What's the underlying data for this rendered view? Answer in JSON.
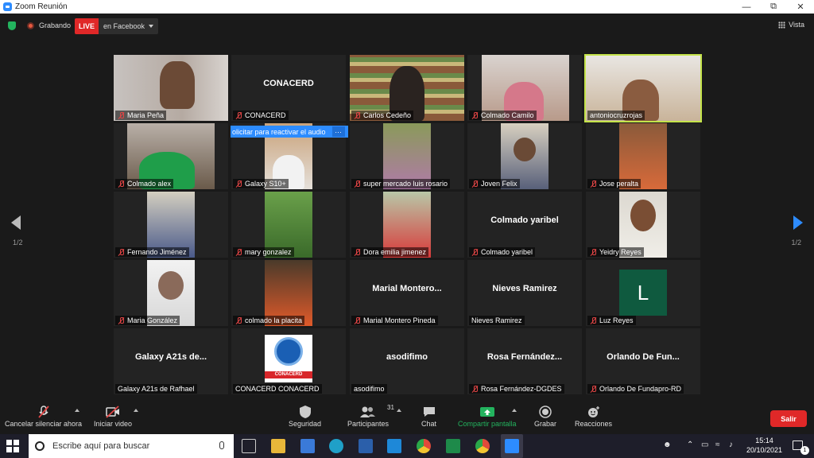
{
  "window": {
    "title": "Zoom Reunión"
  },
  "topbar": {
    "recording_label": "Grabando",
    "live_label": "LIVE",
    "live_destination": "en Facebook",
    "view_label": "Vista"
  },
  "navigation": {
    "page_left": "1/2",
    "page_right": "1/2"
  },
  "popup": {
    "text": "olicitar para reactivar el audio",
    "more": "···"
  },
  "tiles": [
    {
      "name": "Maria Peña",
      "big": ""
    },
    {
      "name": "CONACERD",
      "big": "CONACERD"
    },
    {
      "name": "Carlos Cedeño",
      "big": ""
    },
    {
      "name": "Colmado Camilo",
      "big": ""
    },
    {
      "name": "antoniocruzrojas",
      "big": ""
    },
    {
      "name": "Colmado alex",
      "big": ""
    },
    {
      "name": "Galaxy S10+",
      "big": ""
    },
    {
      "name": "super mercado luis rosario",
      "big": ""
    },
    {
      "name": "Joven Felix",
      "big": ""
    },
    {
      "name": "Jose peralta",
      "big": ""
    },
    {
      "name": "Fernando Jiménez",
      "big": ""
    },
    {
      "name": "mary gonzalez",
      "big": ""
    },
    {
      "name": "Dora emilia jimenez",
      "big": ""
    },
    {
      "name": "Colmado yaribel",
      "big": "Colmado yaribel"
    },
    {
      "name": "Yeidry Reyes",
      "big": ""
    },
    {
      "name": "Maria González",
      "big": ""
    },
    {
      "name": "colmado la placita",
      "big": ""
    },
    {
      "name": "Marial Montero Pineda",
      "big": "Marial Montero..."
    },
    {
      "name": "Nieves Ramirez",
      "big": "Nieves Ramirez"
    },
    {
      "name": "Luz Reyes",
      "big": "",
      "letter": "L"
    },
    {
      "name": "Galaxy A21s de Rafhael",
      "big": "Galaxy A21s de..."
    },
    {
      "name": "CONACERD CONACERD",
      "big": "",
      "logo_text": "CONACERD"
    },
    {
      "name": "asodifimo",
      "big": "asodifimo"
    },
    {
      "name": "Rosa Fernández-DGDES",
      "big": "Rosa Fernández..."
    },
    {
      "name": "Orlando De Fundapro-RD",
      "big": "Orlando De Fun..."
    }
  ],
  "toolbar": {
    "unmute": "Cancelar silenciar ahora",
    "start_video": "Iniciar video",
    "security": "Seguridad",
    "participants": "Participantes",
    "participants_count": "31",
    "chat": "Chat",
    "share": "Compartir pantalla",
    "record": "Grabar",
    "reactions": "Reacciones",
    "leave": "Salir"
  },
  "taskbar": {
    "search_placeholder": "Escribe aquí para buscar",
    "time": "15:14",
    "date": "20/10/2021",
    "notification_count": "1"
  },
  "colors": {
    "live": "#e02828",
    "active_speaker": "#c4e34a",
    "share": "#23b35e",
    "accent": "#2d8cff"
  }
}
